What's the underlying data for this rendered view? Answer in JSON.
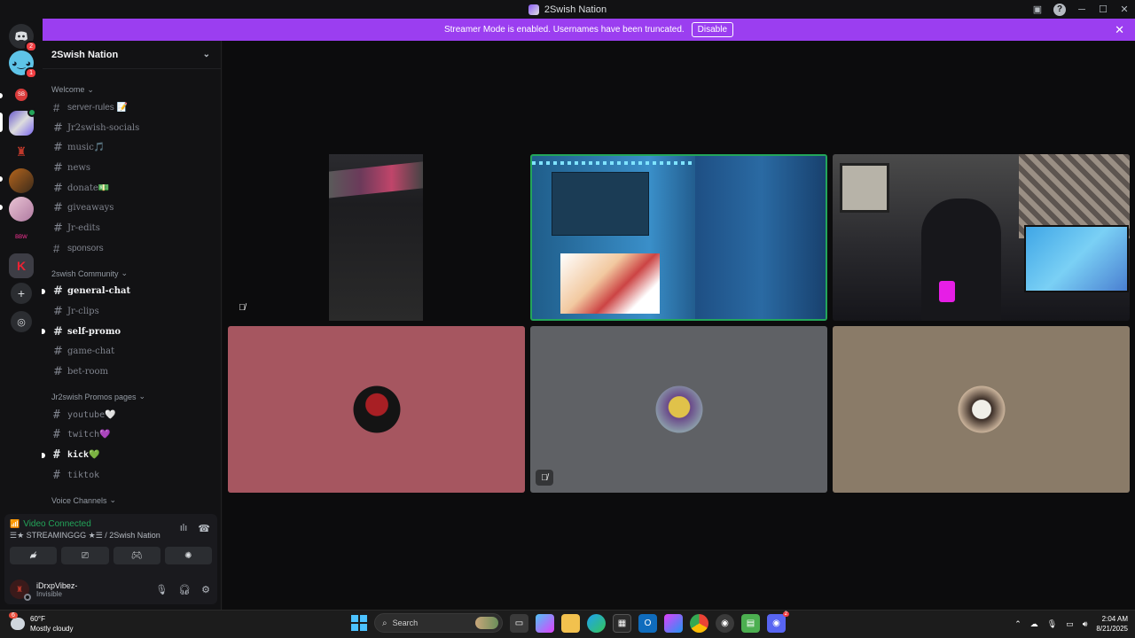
{
  "window": {
    "title": "2Swish Nation"
  },
  "banner": {
    "text": "Streamer Mode is enabled. Usernames have been truncated.",
    "button": "Disable",
    "color": "#9b3ef0"
  },
  "server_rail": {
    "items": [
      {
        "name": "discord-home",
        "badge": "2"
      },
      {
        "name": "server-blue",
        "badge": "1"
      },
      {
        "name": "server-sb",
        "label": "SB"
      },
      {
        "name": "server-2swish",
        "active": true
      },
      {
        "name": "server-red"
      },
      {
        "name": "server-orange"
      },
      {
        "name": "server-anime"
      },
      {
        "name": "server-bbw",
        "label": "BBW"
      },
      {
        "name": "server-k"
      },
      {
        "name": "add-server-icon",
        "label": "+"
      },
      {
        "name": "discover-icon"
      }
    ]
  },
  "guild": {
    "name": "2Swish Nation",
    "categories": [
      {
        "name": "Welcome",
        "channels": [
          {
            "name": "server-rules 📝",
            "style": "plain"
          },
          {
            "name": "Jr2swish-socials",
            "style": "fancy"
          },
          {
            "name": "music🎵",
            "style": "fancy"
          },
          {
            "name": "news",
            "style": "fancy"
          },
          {
            "name": "donate💵",
            "style": "fancy"
          },
          {
            "name": "giveaways",
            "style": "fancy"
          },
          {
            "name": "Jr-edits",
            "style": "fancy"
          },
          {
            "name": "sponsors",
            "style": "plain"
          }
        ]
      },
      {
        "name": "2swish Community",
        "channels": [
          {
            "name": "general-chat",
            "style": "fancy",
            "unread": true
          },
          {
            "name": "Jr-clips",
            "style": "fancy"
          },
          {
            "name": "self-promo",
            "style": "fancy",
            "unread": true
          },
          {
            "name": "game-chat",
            "style": "fancy"
          },
          {
            "name": "bet-room",
            "style": "fancy"
          }
        ]
      },
      {
        "name": "Jr2swish Promos pages",
        "channels": [
          {
            "name": "youtube🤍",
            "style": "mono"
          },
          {
            "name": "twitch💜",
            "style": "mono"
          },
          {
            "name": "kick💚",
            "style": "mono",
            "unread": true
          },
          {
            "name": "tiktok",
            "style": "mono"
          }
        ]
      },
      {
        "name": "Voice Channels",
        "channels": []
      }
    ]
  },
  "voice": {
    "status": "Video Connected",
    "channel": "☰★ STREAMINGGG ★☰ / 2Swish Nation",
    "buttons": [
      "camera-off",
      "screen-share",
      "activities",
      "soundboard"
    ]
  },
  "user": {
    "name": "iDrxpVibez-",
    "status": "Invisible"
  },
  "tiles": [
    {
      "name": "stream-phone",
      "muted": true,
      "border": "none"
    },
    {
      "name": "stream-blue-room",
      "speaking": true
    },
    {
      "name": "stream-gamer"
    },
    {
      "name": "user-red-tile",
      "bg": "#a65660"
    },
    {
      "name": "user-gray-tile",
      "bg": "#5f6165",
      "muted": true
    },
    {
      "name": "user-tan-tile",
      "bg": "#8a7b68"
    }
  ],
  "taskbar": {
    "weather_temp": "60°F",
    "weather_desc": "Mostly cloudy",
    "weather_badge": "6",
    "search_placeholder": "Search",
    "discord_badge": "2",
    "time": "2:04 AM",
    "date": "8/21/2025"
  }
}
